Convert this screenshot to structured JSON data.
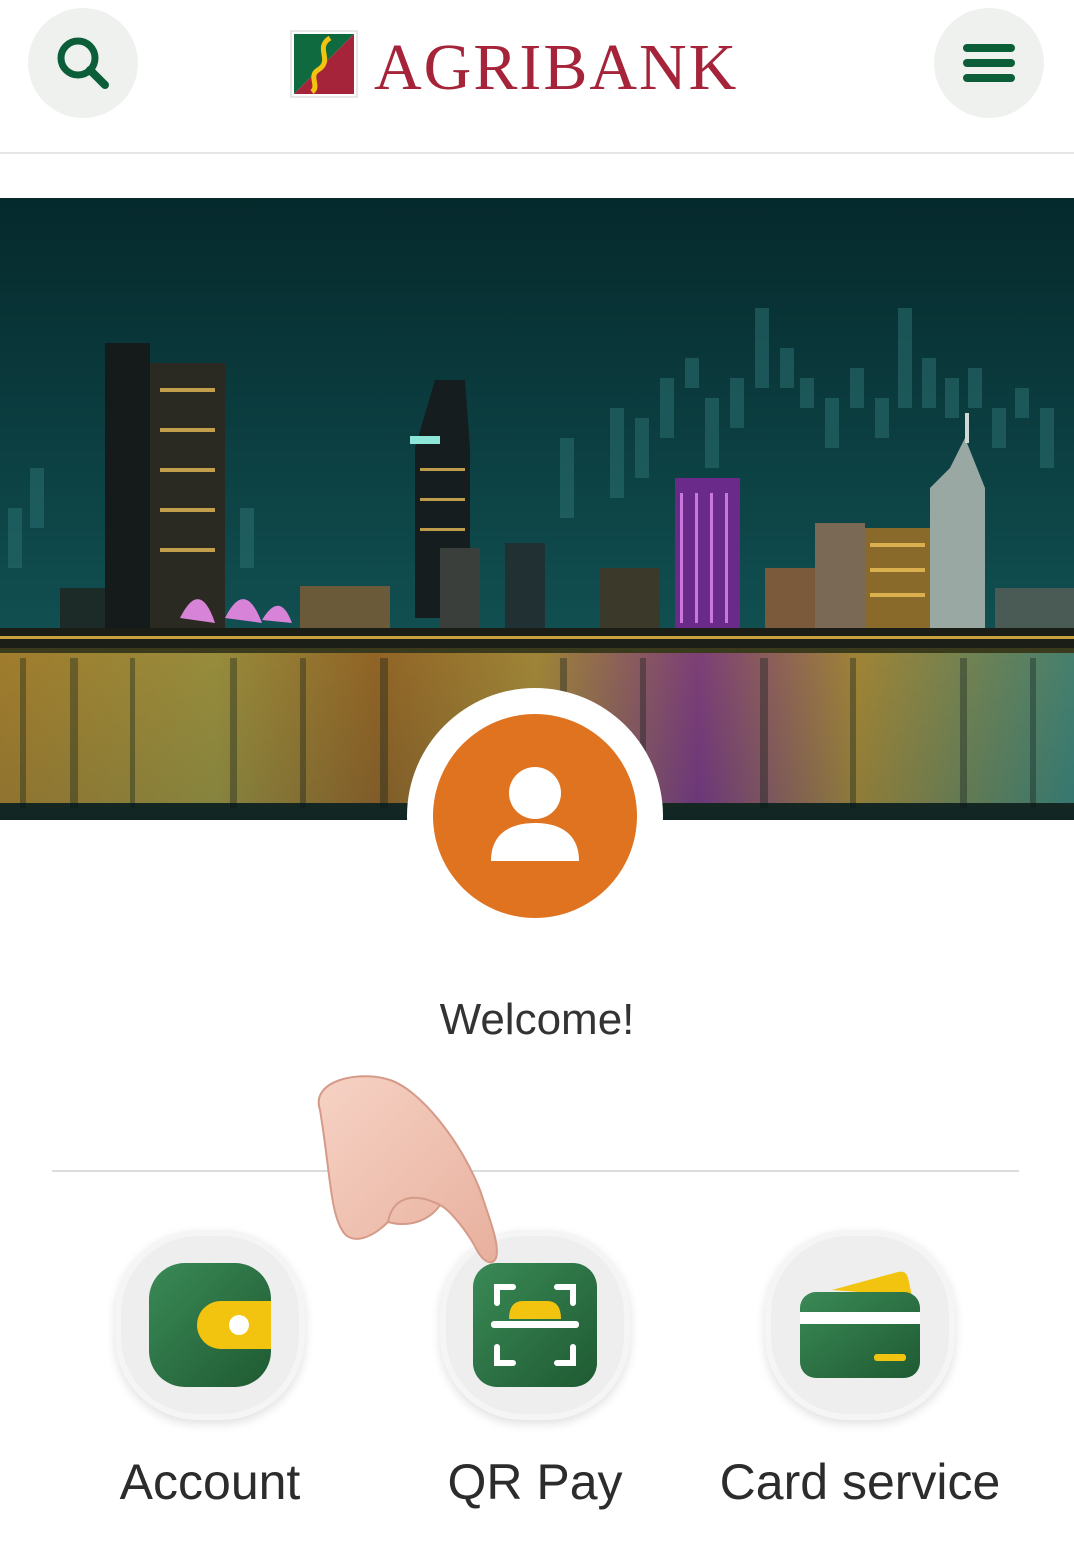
{
  "header": {
    "brand": "AGRIBANK",
    "search_icon": "search-icon",
    "menu_icon": "hamburger-menu-icon"
  },
  "banner": {
    "description_icon": "city-skyline-image"
  },
  "profile": {
    "avatar_icon": "user-avatar-icon",
    "welcome": "Welcome!"
  },
  "services": [
    {
      "label": "Account",
      "icon": "wallet-icon"
    },
    {
      "label": "QR Pay",
      "icon": "qr-scan-icon"
    },
    {
      "label": "Card service",
      "icon": "card-icon"
    }
  ],
  "colors": {
    "brand_red": "#a5243a",
    "brand_green": "#0f6b3f",
    "avatar_orange": "#e07320",
    "accent_yellow": "#f2c40f"
  }
}
